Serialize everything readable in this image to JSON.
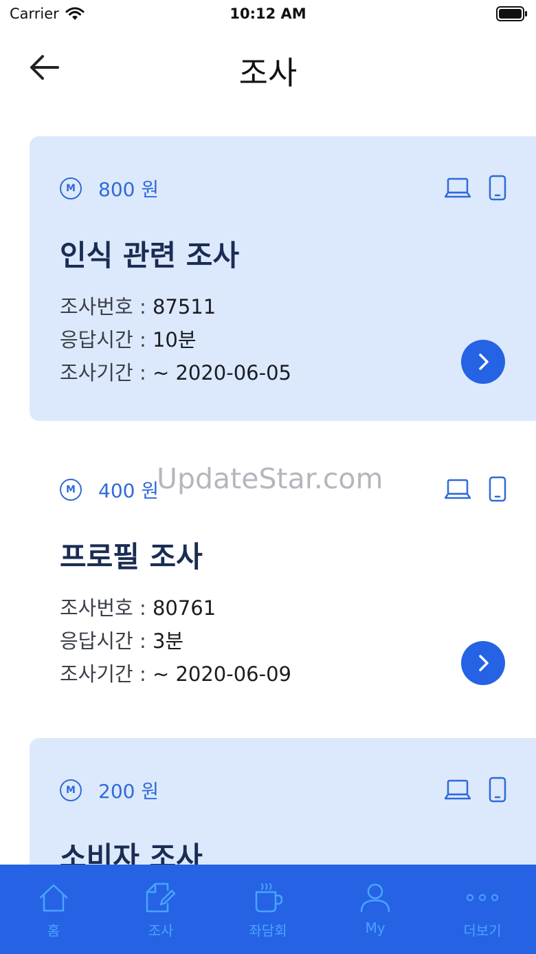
{
  "status_bar": {
    "carrier": "Carrier",
    "time": "10:12 AM"
  },
  "header": {
    "title": "조사"
  },
  "surveys": [
    {
      "reward": "800 원",
      "coin_letter": "M",
      "title": "인식 관련 조사",
      "survey_no_label": "조사번호 : ",
      "survey_no": "87511",
      "duration_label": "응답시간 : ",
      "duration": "10분",
      "period_label": "조사기간 : ",
      "period": "~ 2020-06-05"
    },
    {
      "reward": "400 원",
      "coin_letter": "M",
      "title": "프로필 조사",
      "survey_no_label": "조사번호 : ",
      "survey_no": "80761",
      "duration_label": "응답시간 : ",
      "duration": "3분",
      "period_label": "조사기간 : ",
      "period": "~ 2020-06-09"
    },
    {
      "reward": "200 원",
      "coin_letter": "M",
      "title": "소비자 조사"
    }
  ],
  "watermark": "UpdateStar.com",
  "tabbar": {
    "items": [
      {
        "label": "홈",
        "icon": "home-icon"
      },
      {
        "label": "조사",
        "icon": "survey-edit-icon"
      },
      {
        "label": "좌담회",
        "icon": "coffee-cup-icon"
      },
      {
        "label": "My",
        "icon": "user-icon"
      },
      {
        "label": "더보기",
        "icon": "more-dots-icon"
      }
    ]
  },
  "colors": {
    "accent": "#2563e4",
    "card_bg": "#dce9fc",
    "reward": "#2f6ad8",
    "tab_label": "#4aa3ff"
  }
}
